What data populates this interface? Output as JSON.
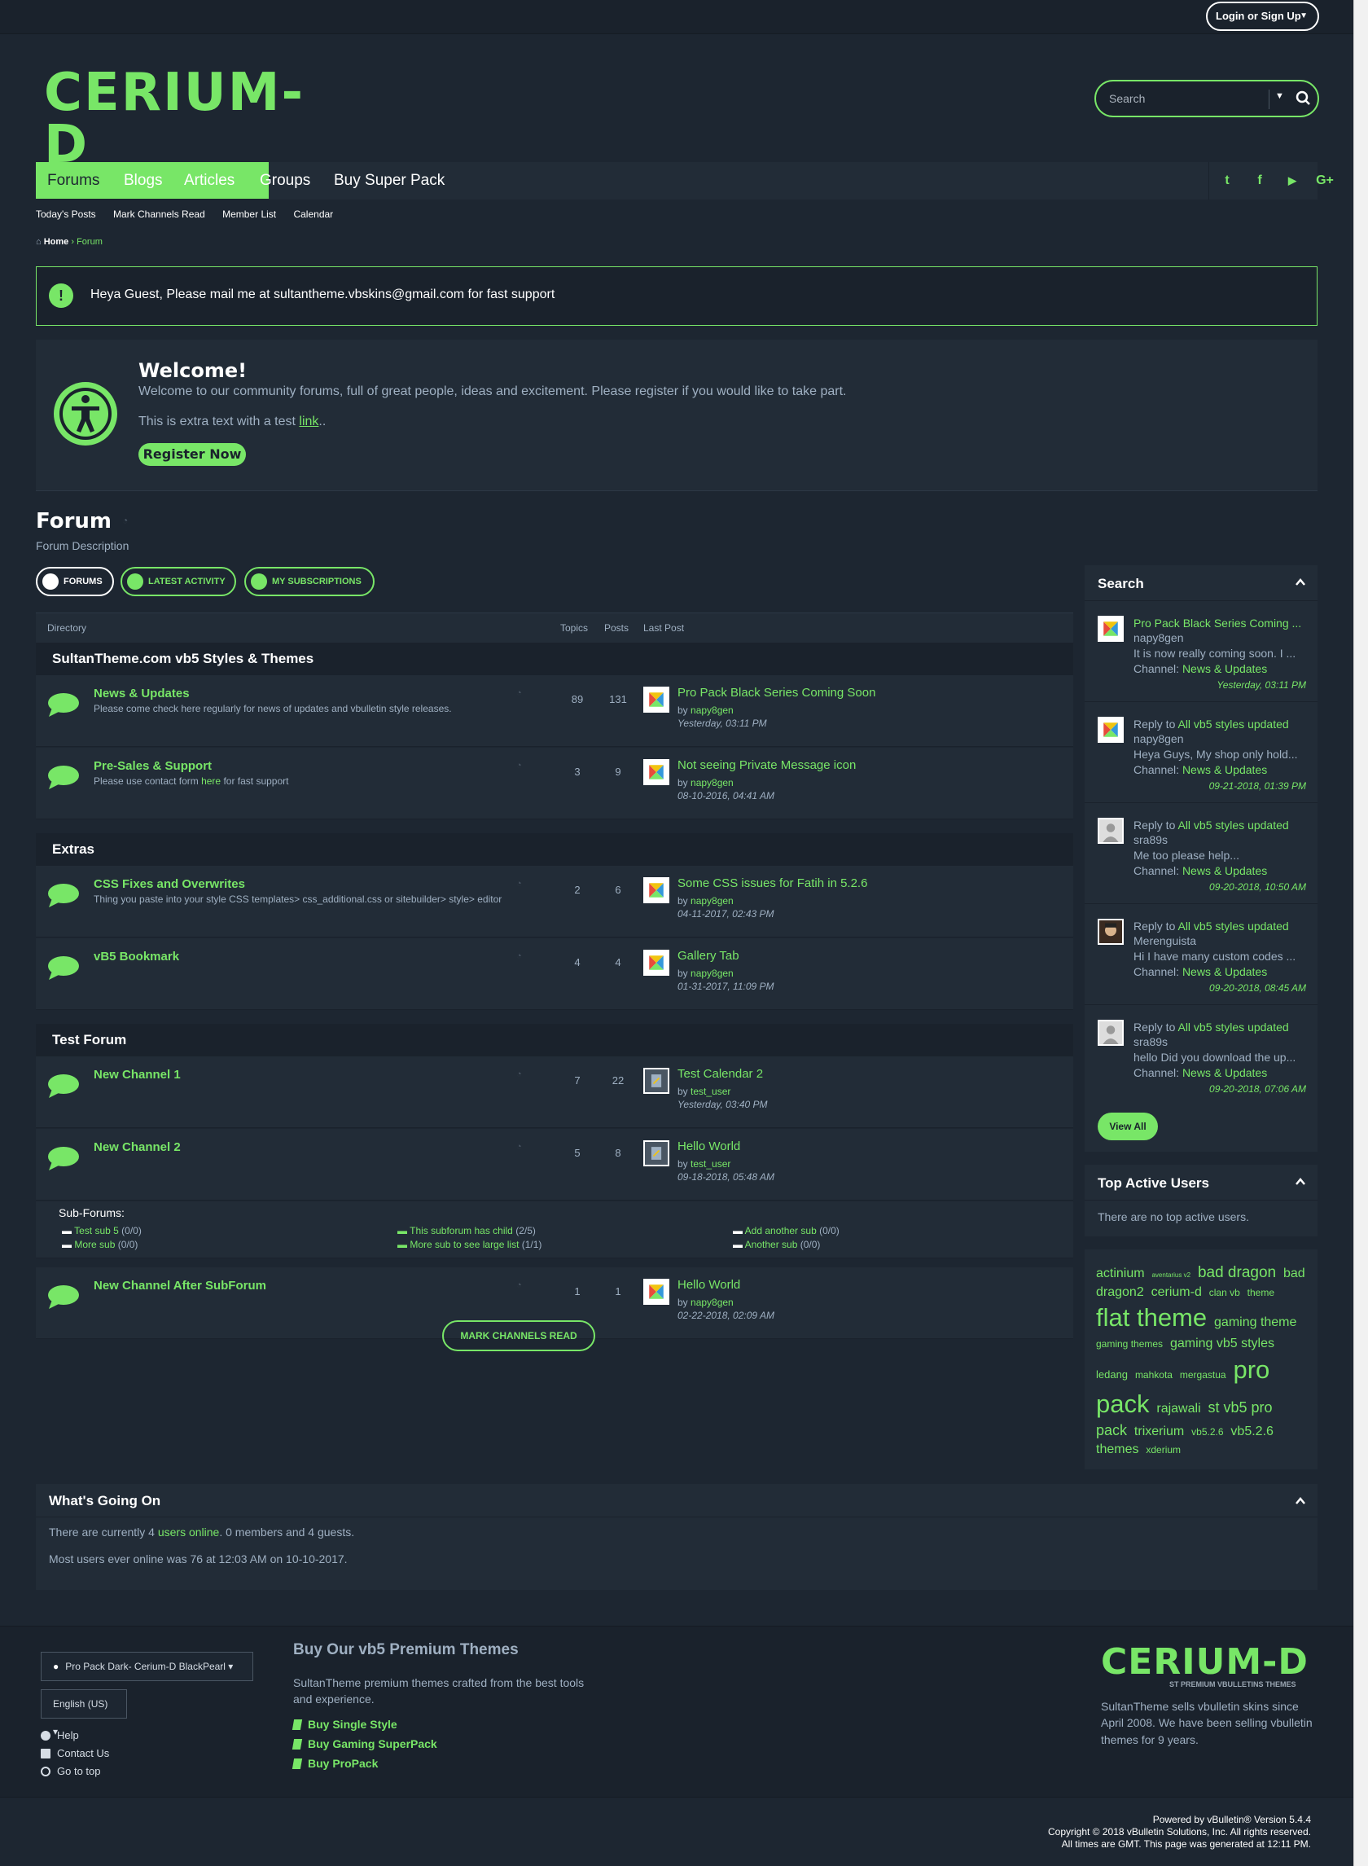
{
  "colors": {
    "accent": "#78e667",
    "bg": "#1d2631",
    "panel": "#222c37"
  },
  "topbar": {
    "login": "Login or Sign Up"
  },
  "logo": {
    "wordmark": "CERIUM-D",
    "tagline": "ST PREMIUM VBULLETINS THEMES"
  },
  "search": {
    "placeholder": "Search"
  },
  "nav": {
    "items": [
      "Forums",
      "Blogs",
      "Articles",
      "Groups",
      "Buy Super Pack"
    ],
    "social": [
      "twitter-icon",
      "facebook-icon",
      "youtube-icon",
      "google-plus-icon"
    ],
    "social_glyphs": [
      "t",
      "f",
      "▶",
      "G+"
    ]
  },
  "subnav": [
    "Today's Posts",
    "Mark Channels Read",
    "Member List",
    "Calendar"
  ],
  "breadcrumb": {
    "home": "Home",
    "current": "Forum"
  },
  "notice": {
    "text": "Heya Guest, Please mail me at sultantheme.vbskins@gmail.com for fast support"
  },
  "welcome": {
    "title": "Welcome!",
    "line1": "Welcome to our community forums, full of great people, ideas and excitement. Please register if you would like to take part.",
    "line2_prefix": "This is extra text with a test ",
    "line2_link": "link",
    "line2_suffix": "..",
    "register": "Register Now"
  },
  "forum": {
    "title": "Forum",
    "description": "Forum Description"
  },
  "tabs": [
    "FORUMS",
    "LATEST ACTIVITY",
    "MY SUBSCRIPTIONS"
  ],
  "table": {
    "headers": {
      "directory": "Directory",
      "topics": "Topics",
      "posts": "Posts",
      "last_post": "Last Post"
    },
    "sections": [
      {
        "title": "SultanTheme.com vb5 Styles & Themes",
        "rows": [
          {
            "title": "News & Updates",
            "desc": "Please come check here regularly for news of updates and vbulletin style releases.",
            "topics": "89",
            "posts": "131",
            "last": "Pro Pack Black Series Coming Soon",
            "by": "by ",
            "user": "napy8gen",
            "date": "Yesterday, 03:11 PM"
          },
          {
            "title": "Pre-Sales & Support",
            "desc": "Please use contact form ",
            "desc_link": "here",
            "desc_after": " for fast support",
            "topics": "3",
            "posts": "9",
            "last": "Not seeing Private Message icon",
            "by": "by ",
            "user": "napy8gen",
            "date": "08-10-2016, 04:41 AM"
          }
        ]
      },
      {
        "title": "Extras",
        "rows": [
          {
            "title": "CSS Fixes and Overwrites",
            "desc": "Thing you paste into your style CSS templates> css_additional.css or sitebuilder> style> editor",
            "topics": "2",
            "posts": "6",
            "last": "Some CSS issues for Fatih in 5.2.6",
            "by": "by ",
            "user": "napy8gen",
            "date": "04-11-2017, 02:43 PM"
          },
          {
            "title": "vB5 Bookmark",
            "desc": "",
            "topics": "4",
            "posts": "4",
            "last": "Gallery Tab",
            "by": "by ",
            "user": "napy8gen",
            "date": "01-31-2017, 11:09 PM"
          }
        ]
      },
      {
        "title": "Test Forum",
        "rows": [
          {
            "title": "New Channel 1",
            "desc": "",
            "topics": "7",
            "posts": "22",
            "last": "Test Calendar 2",
            "by": "by ",
            "user": "test_user",
            "date": "Yesterday, 03:40 PM"
          },
          {
            "title": "New Channel 2",
            "desc": "",
            "topics": "5",
            "posts": "8",
            "last": "Hello World",
            "by": "by ",
            "user": "test_user",
            "date": "09-18-2018, 05:48 AM"
          },
          {
            "title": "New Channel After SubForum",
            "desc": "",
            "topics": "1",
            "posts": "1",
            "last": "Hello World",
            "by": "by ",
            "user": "napy8gen",
            "date": "02-22-2018, 02:09 AM"
          }
        ]
      }
    ],
    "subforums": {
      "label": "Sub-Forums:",
      "items": [
        {
          "name": "Test sub 5",
          "count": " (0/0)"
        },
        {
          "name": "More sub",
          "count": " (0/0)"
        },
        {
          "name": "This subforum has child",
          "count": " (2/5)"
        },
        {
          "name": "More sub to see large list",
          "count": " (1/1)"
        },
        {
          "name": "Add another sub",
          "count": " (0/0)"
        },
        {
          "name": "Another sub",
          "count": " (0/0)"
        }
      ]
    }
  },
  "mark_read": "MARK CHANNELS READ",
  "sidebar": {
    "search_title": "Search",
    "activity": [
      {
        "prefix": "",
        "title": "Pro Pack Black Series Coming ...",
        "user": "napy8gen",
        "snippet": "It is now really coming soon. I ...",
        "channel_label": "Channel: ",
        "channel": "News & Updates",
        "time": "Yesterday, 03:11 PM"
      },
      {
        "prefix": "Reply to ",
        "title": "All vb5 styles updated",
        "user": "napy8gen",
        "snippet": "Heya Guys, My shop only hold...",
        "channel_label": "Channel: ",
        "channel": "News & Updates",
        "time": "09-21-2018, 01:39 PM"
      },
      {
        "prefix": "Reply to ",
        "title": "All vb5 styles updated",
        "user": "sra89s",
        "snippet": "Me too please help...",
        "channel_label": "Channel: ",
        "channel": "News & Updates",
        "time": "09-20-2018, 10:50 AM"
      },
      {
        "prefix": "Reply to ",
        "title": "All vb5 styles updated",
        "user": "Merenguista",
        "snippet": "Hi I have many custom codes ...",
        "channel_label": "Channel: ",
        "channel": "News & Updates",
        "time": "09-20-2018, 08:45 AM"
      },
      {
        "prefix": "Reply to ",
        "title": "All vb5 styles updated",
        "user": "sra89s",
        "snippet": "hello Did you download the up...",
        "channel_label": "Channel: ",
        "channel": "News & Updates",
        "time": "09-20-2018, 07:06 AM"
      }
    ],
    "view_all": "View All",
    "top_users_title": "Top Active Users",
    "top_users_empty": "There are no top active users.",
    "tags": [
      {
        "t": "actinium",
        "s": 16
      },
      {
        "t": "aventarius v2",
        "s": 8
      },
      {
        "t": "bad dragon",
        "s": 19
      },
      {
        "t": "bad dragon2",
        "s": 16
      },
      {
        "t": "cerium-d",
        "s": 16
      },
      {
        "t": "clan vb",
        "s": 12
      },
      {
        "t": "theme",
        "s": 12
      },
      {
        "t": "flat theme",
        "s": 31
      },
      {
        "t": "gaming theme",
        "s": 16
      },
      {
        "t": "gaming themes",
        "s": 12
      },
      {
        "t": "gaming vb5 styles",
        "s": 16
      },
      {
        "t": "ledang",
        "s": 13
      },
      {
        "t": "mahkota",
        "s": 12
      },
      {
        "t": "mergastua",
        "s": 12
      },
      {
        "t": "pro pack",
        "s": 31
      },
      {
        "t": "rajawali",
        "s": 16
      },
      {
        "t": "st vb5 pro pack",
        "s": 18
      },
      {
        "t": "trixerium",
        "s": 16
      },
      {
        "t": "vb5.2.6",
        "s": 12
      },
      {
        "t": "vb5.2.6 themes",
        "s": 16
      },
      {
        "t": "xderium",
        "s": 12
      }
    ]
  },
  "wgo": {
    "title": "What's Going On",
    "l1_a": "There are currently 4 ",
    "l1_link": "users online",
    "l1_b": ". 0 members and 4 guests.",
    "l2": "Most users ever online was 76 at 12:03 AM on 10-10-2017."
  },
  "footer": {
    "style_select": "Pro Pack Dark- Cerium-D BlackPearl",
    "lang_select": "English (US)",
    "links": [
      "Help",
      "Contact Us",
      "Go to top"
    ],
    "heading": "Buy Our vb5 Premium Themes",
    "para": "SultanTheme premium themes crafted from the best tools and experience.",
    "buy": [
      "Buy Single Style",
      "Buy Gaming SuperPack",
      "Buy ProPack"
    ],
    "about": "SultanTheme sells vbulletin skins since April 2008. We have been selling vbulletin themes for 9 years."
  },
  "copyright": [
    "Powered by vBulletin® Version 5.4.4",
    "Copyright © 2018 vBulletin Solutions, Inc. All rights reserved.",
    "All times are GMT. This page was generated at 12:11 PM."
  ]
}
